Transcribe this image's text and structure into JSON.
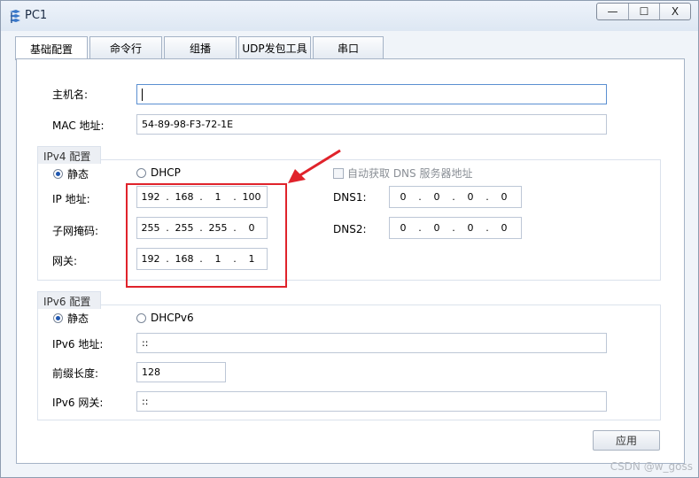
{
  "window": {
    "title": "PC1",
    "minimize_label": "—",
    "maximize_label": "☐",
    "close_label": "X"
  },
  "tabs": [
    {
      "label": "基础配置",
      "active": true
    },
    {
      "label": "命令行"
    },
    {
      "label": "组播"
    },
    {
      "label": "UDP发包工具"
    },
    {
      "label": "串口"
    }
  ],
  "basic": {
    "hostname_label": "主机名:",
    "hostname_value": "",
    "mac_label": "MAC 地址:",
    "mac_value": "54-89-98-F3-72-1E"
  },
  "ipv4": {
    "group_label": "IPv4 配置",
    "static_label": "静态",
    "dhcp_label": "DHCP",
    "auto_dns_label": "自动获取 DNS 服务器地址",
    "ip_label": "IP 地址:",
    "ip": [
      "192",
      "168",
      "1",
      "100"
    ],
    "mask_label": "子网掩码:",
    "mask": [
      "255",
      "255",
      "255",
      "0"
    ],
    "gateway_label": "网关:",
    "gateway": [
      "192",
      "168",
      "1",
      "1"
    ],
    "dns1_label": "DNS1:",
    "dns1": [
      "0",
      "0",
      "0",
      "0"
    ],
    "dns2_label": "DNS2:",
    "dns2": [
      "0",
      "0",
      "0",
      "0"
    ]
  },
  "ipv6": {
    "group_label": "IPv6 配置",
    "static_label": "静态",
    "dhcp_label": "DHCPv6",
    "address_label": "IPv6 地址:",
    "address_value": "::",
    "prefix_label": "前缀长度:",
    "prefix_value": "128",
    "gateway_label": "IPv6 网关:",
    "gateway_value": "::"
  },
  "apply_label": "应用",
  "watermark": "CSDN @w_goss",
  "colors": {
    "highlight": "#e0232b",
    "accent": "#1f57b0"
  }
}
